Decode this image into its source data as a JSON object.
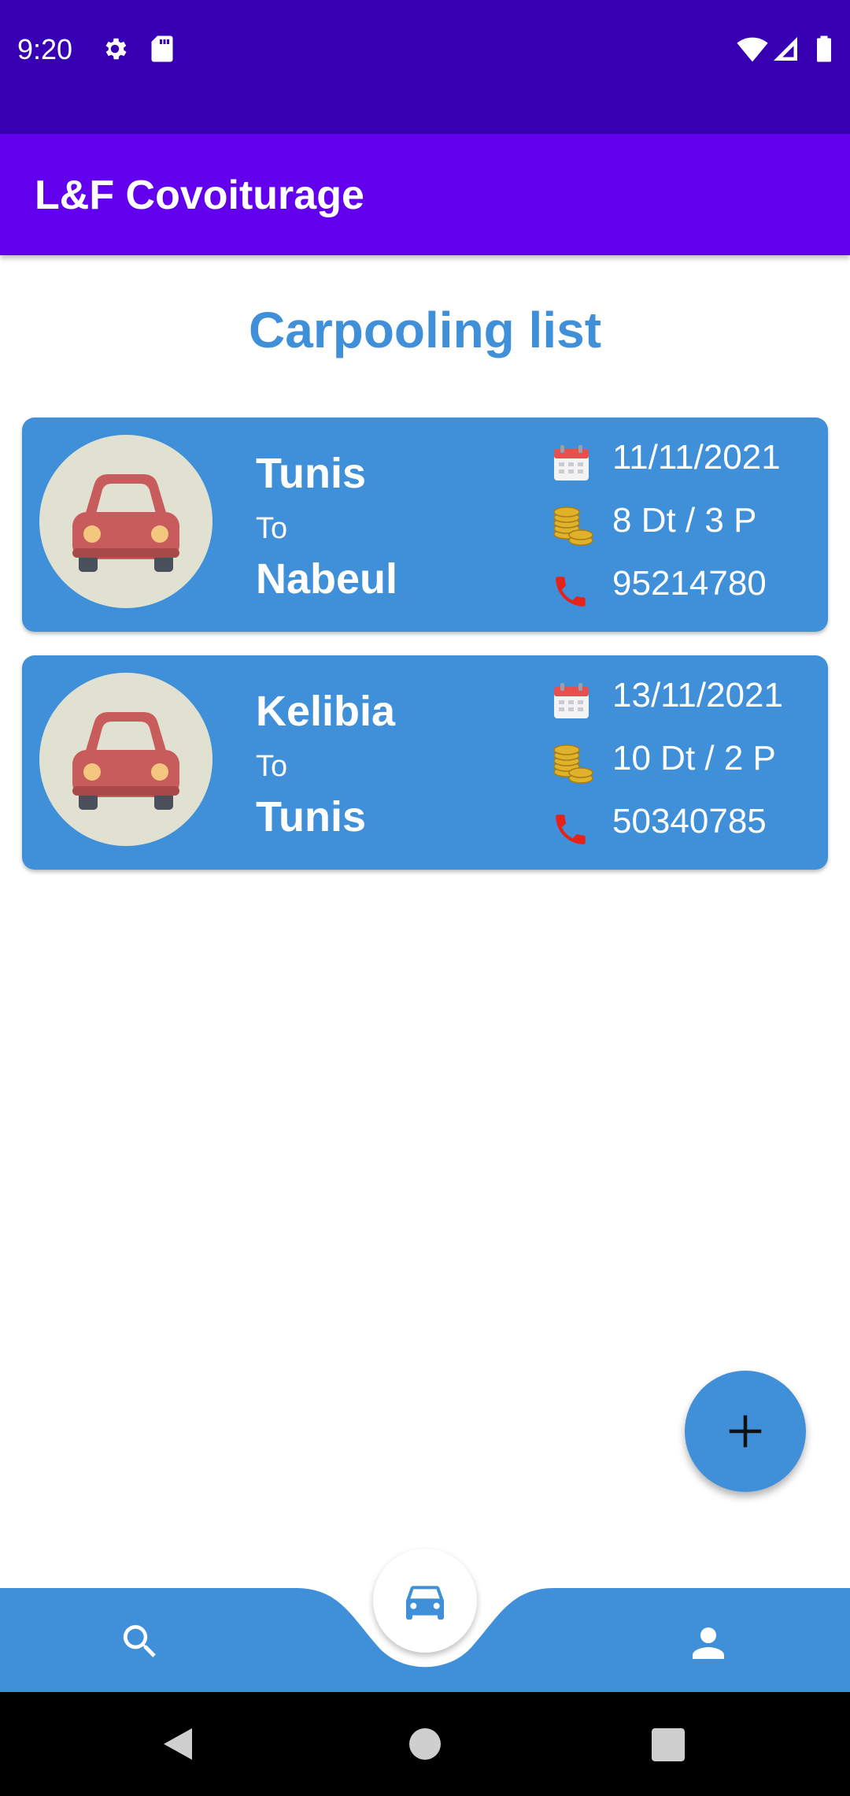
{
  "status_bar": {
    "time": "9:20"
  },
  "app_bar": {
    "title": "L&F Covoiturage"
  },
  "page": {
    "title": "Carpooling list"
  },
  "rides": [
    {
      "from": "Tunis",
      "to_label": "To",
      "destination": "Nabeul",
      "date": "11/11/2021",
      "price": "8 Dt  / 3 P",
      "phone": "95214780"
    },
    {
      "from": "Kelibia",
      "to_label": "To",
      "destination": "Tunis",
      "date": "13/11/2021",
      "price": "10 Dt  / 2 P",
      "phone": "50340785"
    }
  ],
  "icons": {
    "status": [
      "settings-icon",
      "sd-card-icon",
      "wifi-icon",
      "signal-icon",
      "battery-icon"
    ],
    "card": [
      "car-icon",
      "calendar-icon",
      "coins-icon",
      "phone-icon"
    ],
    "fab": "add-icon",
    "bottom_nav": [
      "search-icon",
      "car-icon",
      "person-icon"
    ],
    "system_nav": [
      "back-icon",
      "home-icon",
      "recents-icon"
    ]
  },
  "colors": {
    "status_bar": "#3700b3",
    "app_bar": "#6200ee",
    "accent": "#3f8fd9",
    "phone_icon": "#e5231b"
  }
}
